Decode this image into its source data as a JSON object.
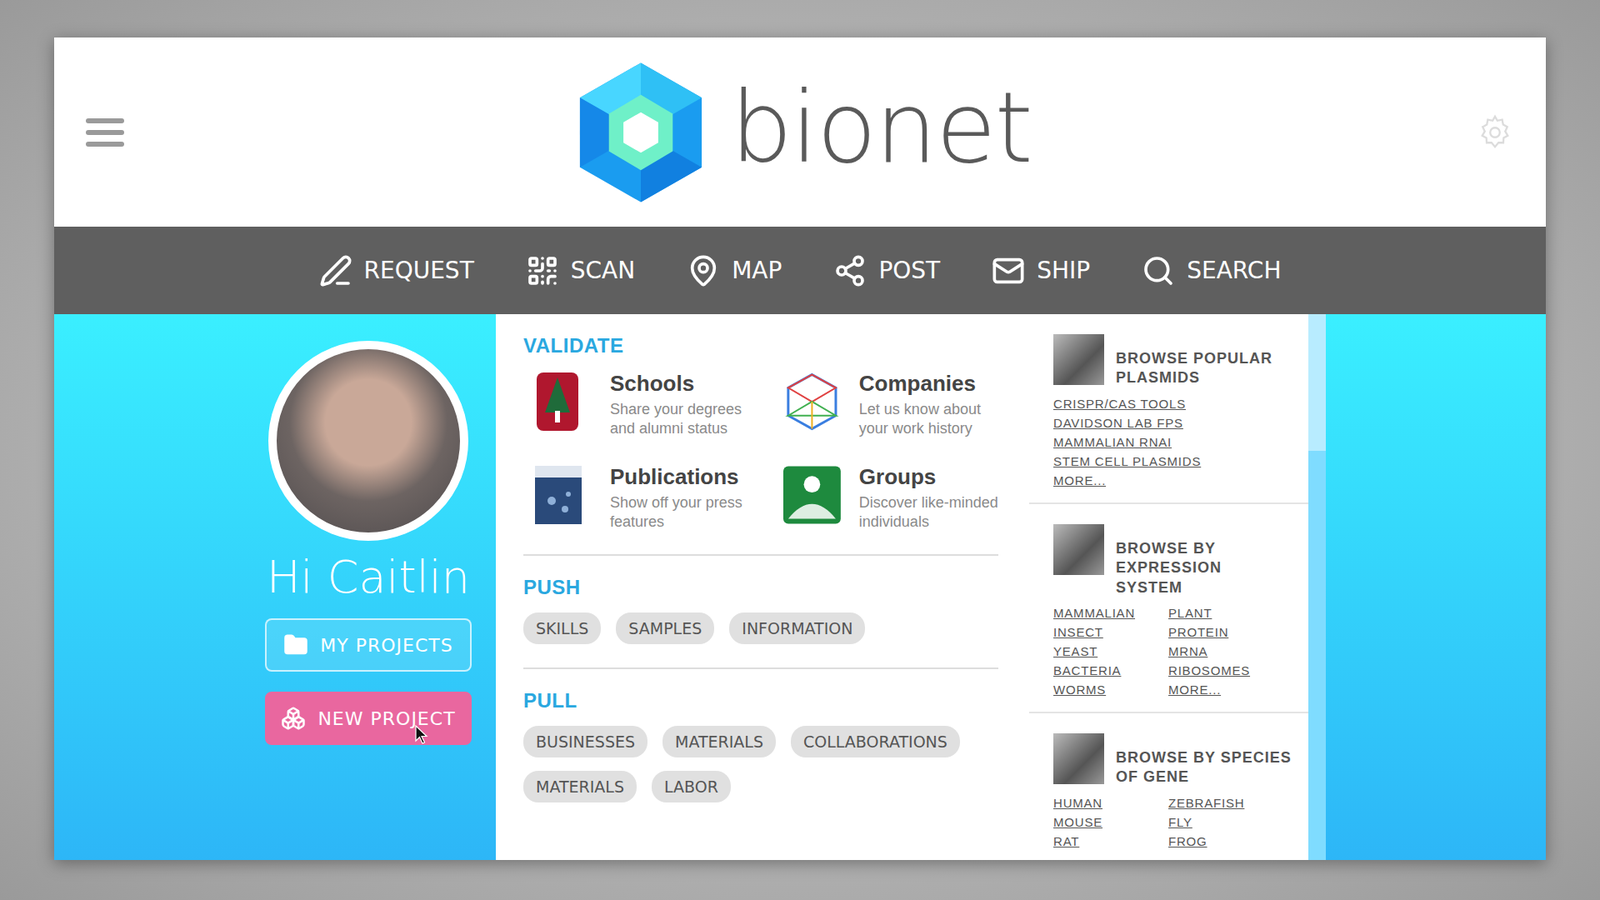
{
  "header": {
    "logo": "bionet"
  },
  "nav": [
    "REQUEST",
    "SCAN",
    "MAP",
    "POST",
    "SHIP",
    "SEARCH"
  ],
  "profile": {
    "greeting": "Hi Caitlin",
    "buttons": [
      {
        "label": "MY PROJECTS",
        "kind": "outline"
      },
      {
        "label": "NEW PROJECT",
        "kind": "filled"
      }
    ]
  },
  "validate": {
    "title": "VALIDATE",
    "items": [
      {
        "title": "Schools",
        "desc": "Share your degrees and alumni status",
        "kind": "school"
      },
      {
        "title": "Companies",
        "desc": "Let us know about your work history",
        "kind": "company"
      },
      {
        "title": "Publications",
        "desc": "Show off your press features",
        "kind": "publication"
      },
      {
        "title": "Groups",
        "desc": "Discover like-minded individuals",
        "kind": "group"
      }
    ]
  },
  "push": {
    "title": "PUSH",
    "tags": [
      "SKILLS",
      "SAMPLES",
      "INFORMATION"
    ]
  },
  "pull": {
    "title": "PULL",
    "tags": [
      "BUSINESSES",
      "MATERIALS",
      "COLLABORATIONS",
      "MATERIALS",
      "LABOR"
    ]
  },
  "browse": [
    {
      "title": "BROWSE POPULAR PLASMIDS",
      "columns": [
        [
          "CRISPR/CAS TOOLS",
          "DAVIDSON LAB FPS",
          "MAMMALIAN RNAI",
          "STEM CELL PLASMIDS",
          "MORE..."
        ]
      ]
    },
    {
      "title": "BROWSE BY EXPRESSION SYSTEM",
      "columns": [
        [
          "MAMMALIAN",
          "INSECT",
          "YEAST",
          "BACTERIA",
          "WORMS"
        ],
        [
          "PLANT",
          "PROTEIN",
          "MRNA",
          "RIBOSOMES",
          "MORE..."
        ]
      ]
    },
    {
      "title": "BROWSE BY SPECIES OF GENE",
      "columns": [
        [
          "HUMAN",
          "MOUSE",
          "RAT"
        ],
        [
          "ZEBRAFISH",
          "FLY",
          "FROG"
        ]
      ]
    }
  ],
  "scrollbar": {
    "level": 0.25
  }
}
